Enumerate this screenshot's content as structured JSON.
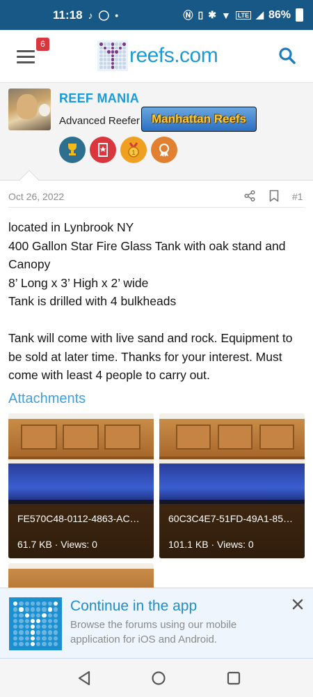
{
  "status_bar": {
    "time": "11:18",
    "battery": "86%",
    "network": "LTE"
  },
  "header": {
    "notification_count": "6",
    "logo_text": "reefs.com"
  },
  "user": {
    "name": "REEF MANIA",
    "title": "Advanced Reefer",
    "banner": "Manhattan Reefs",
    "trophy_icons": [
      "trophy-icon",
      "ribbon-icon",
      "medal-1-icon",
      "medal-icon"
    ],
    "trophy_colors": [
      "#2c6f8f",
      "#d9363e",
      "#f0a020",
      "#e08030"
    ]
  },
  "post": {
    "date": "Oct 26, 2022",
    "number": "#1",
    "body": [
      "located in Lynbrook NY",
      "400 Gallon Star Fire Glass Tank with oak stand and Canopy",
      "8’ Long x 3’ High x 2’ wide",
      "Tank is drilled with 4 bulkheads",
      "",
      "Tank will come with live sand and rock. Equipment to be sold at later time. Thanks for your interest. Must come with least 4 people to carry out."
    ]
  },
  "attachments": {
    "title": "Attachments",
    "items": [
      {
        "name": "FE570C48-0112-4863-AC…",
        "meta": "61.7 KB · Views: 0"
      },
      {
        "name": "60C3C4E7-51FD-49A1-85…",
        "meta": "101.1 KB · Views: 0"
      }
    ]
  },
  "app_banner": {
    "title": "Continue in the app",
    "description": "Browse the forums using our mobile application for iOS and Android."
  },
  "colors": {
    "status_bar": "#185886",
    "link_blue": "#1b9ad6",
    "attachments_title": "#3aa0e0",
    "badge_red": "#d9363e"
  }
}
